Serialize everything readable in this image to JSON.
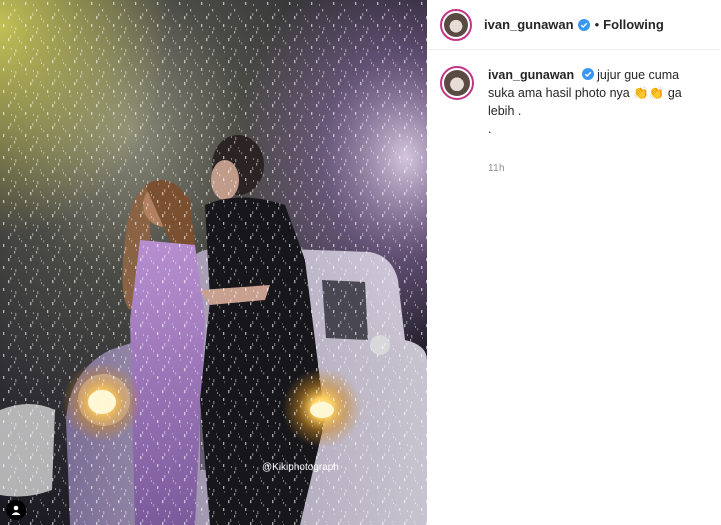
{
  "post": {
    "username": "ivan_gunawan",
    "follow_state": "Following",
    "separator": "•",
    "watermark": "@Kikiphotograph"
  },
  "comment": {
    "username": "ivan_gunawan",
    "text": "jujur gue cuma suka ama hasil photo nya 👏👏 ga lebih .",
    "text_line2": ".",
    "time": "11h"
  },
  "icons": {
    "verified": "verified-badge-icon",
    "user": "user-tag-icon"
  },
  "colors": {
    "verified_blue": "#3897f0",
    "story_ring": "#c13584",
    "text": "#262626",
    "muted": "#8e8e8e"
  }
}
